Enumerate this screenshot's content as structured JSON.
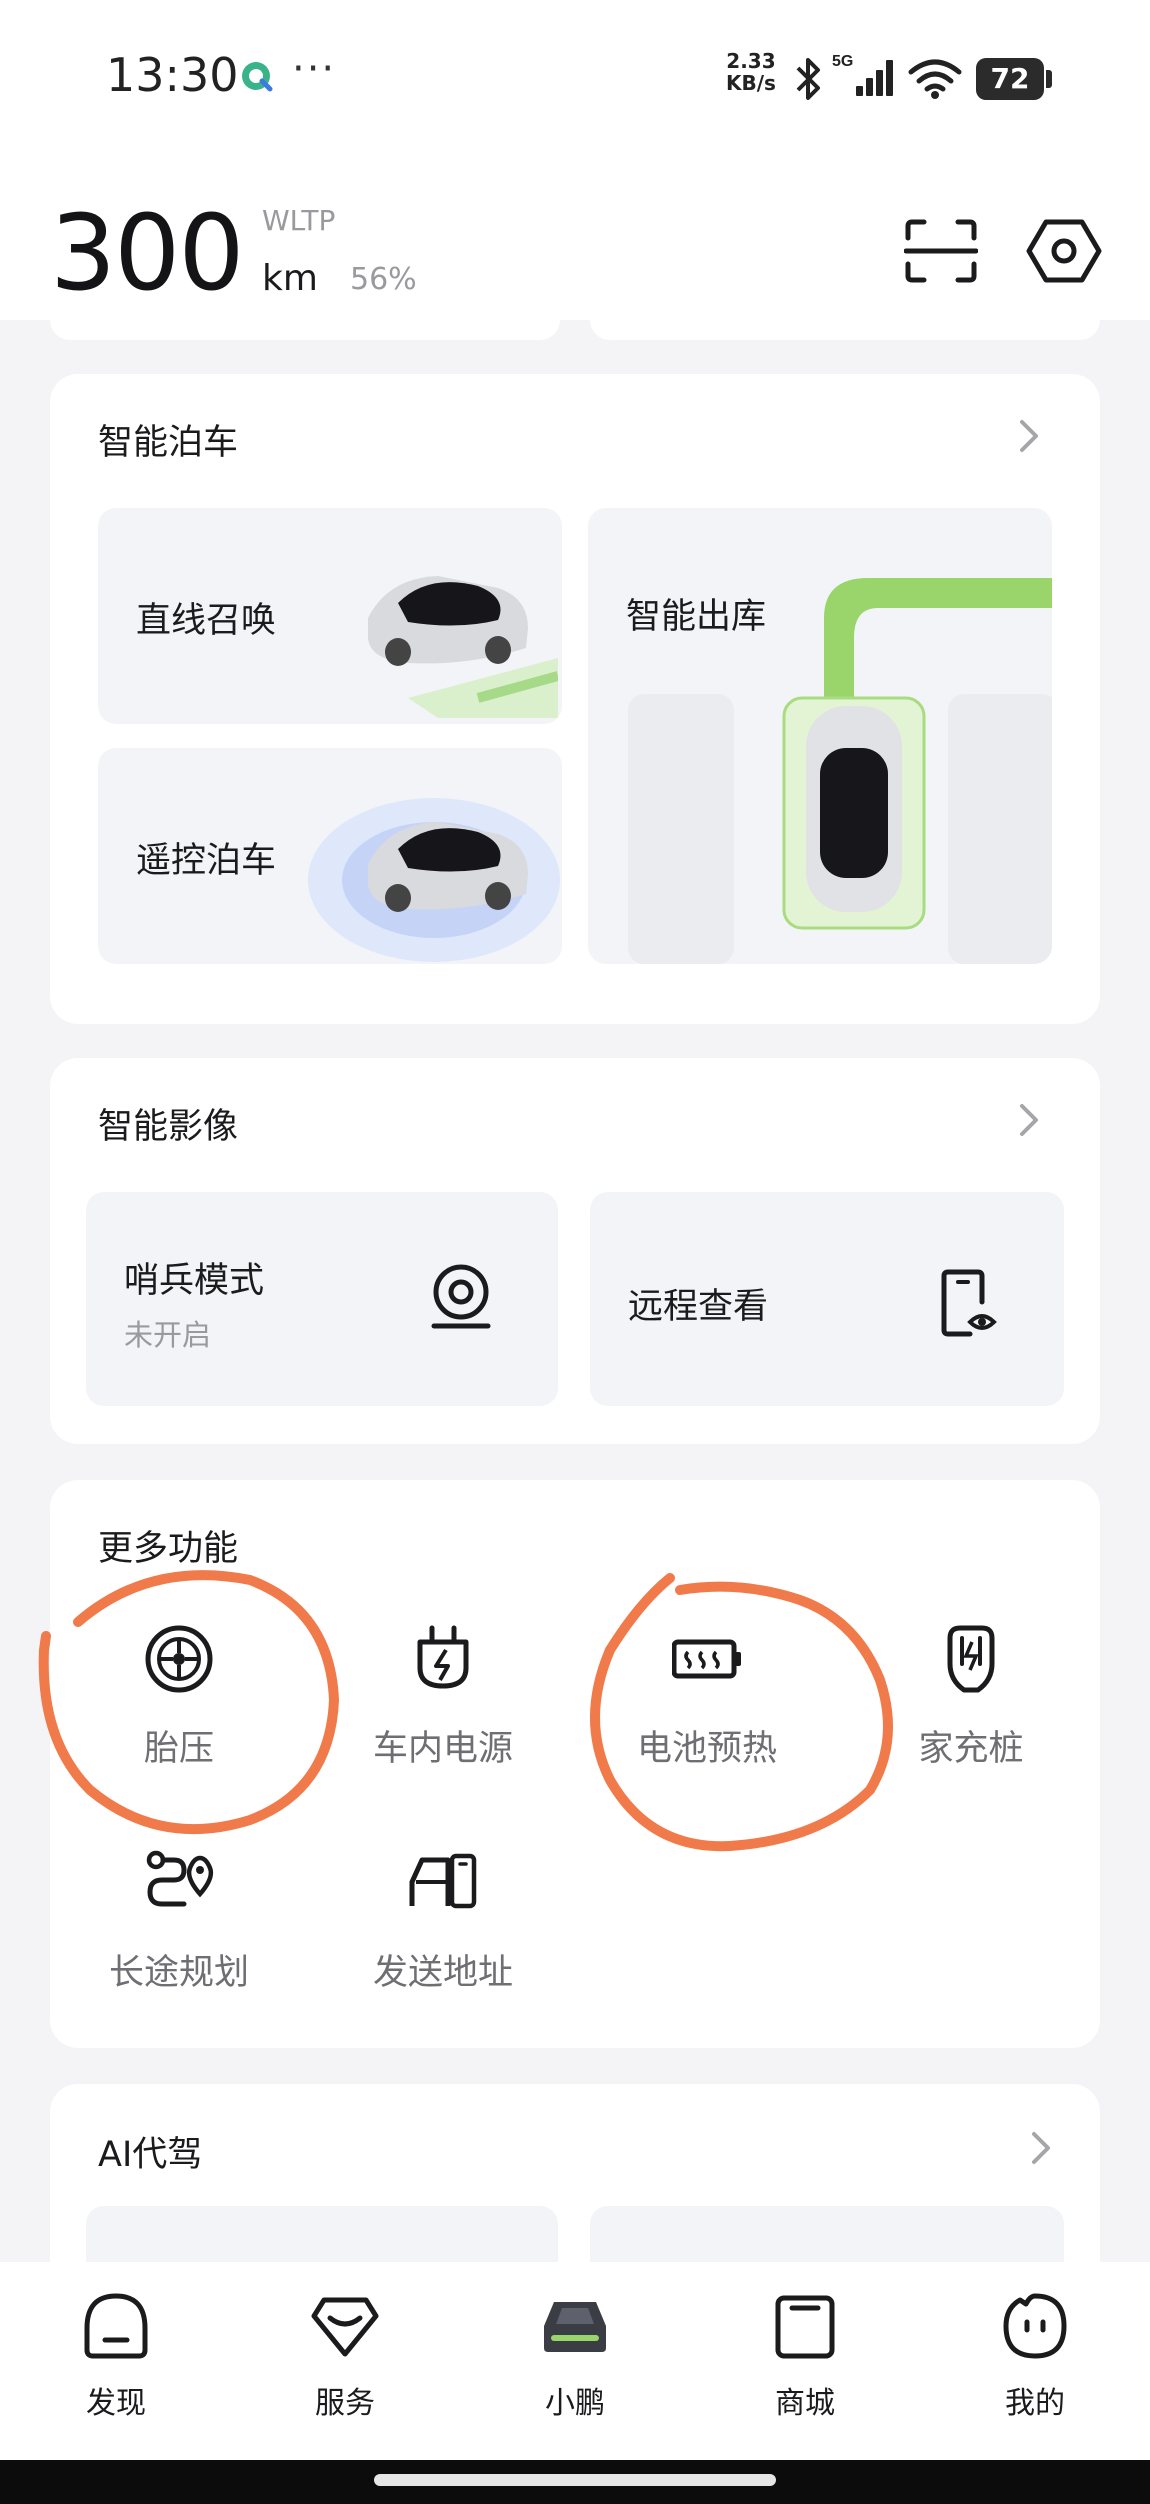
{
  "status_bar": {
    "time": "13:30",
    "dots": "···",
    "net_speed_value": "2.33",
    "net_speed_unit": "KB/s",
    "network": "5G",
    "battery": "72"
  },
  "header": {
    "range_value": "300",
    "range_standard": "WLTP",
    "range_unit": "km",
    "battery_percent": "56%"
  },
  "smart_parking": {
    "title": "智能泊车",
    "tiles": {
      "straight_summon": "直线召唤",
      "remote_parking": "遥控泊车",
      "smart_exit": "智能出库"
    }
  },
  "smart_video": {
    "title": "智能影像",
    "sentry_mode": {
      "label": "哨兵模式",
      "status": "未开启"
    },
    "remote_view": {
      "label": "远程查看"
    }
  },
  "more_functions": {
    "title": "更多功能",
    "items": [
      {
        "label": "胎压",
        "icon": "tire-icon"
      },
      {
        "label": "车内电源",
        "icon": "power-plug-icon"
      },
      {
        "label": "电池预热",
        "icon": "battery-heat-icon"
      },
      {
        "label": "家充桩",
        "icon": "home-charger-icon"
      },
      {
        "label": "长途规划",
        "icon": "route-plan-icon"
      },
      {
        "label": "发送地址",
        "icon": "send-address-icon"
      }
    ]
  },
  "ai_driver": {
    "title": "AI代驾"
  },
  "bottom_nav": {
    "items": [
      {
        "label": "发现",
        "icon": "discover-icon"
      },
      {
        "label": "服务",
        "icon": "service-icon"
      },
      {
        "label": "小鹏",
        "icon": "car-icon"
      },
      {
        "label": "商城",
        "icon": "shop-icon"
      },
      {
        "label": "我的",
        "icon": "profile-icon"
      }
    ]
  },
  "colors": {
    "annotation": "#f07a4a",
    "accent_green": "#8fd35a",
    "background": "#f4f4f6"
  }
}
